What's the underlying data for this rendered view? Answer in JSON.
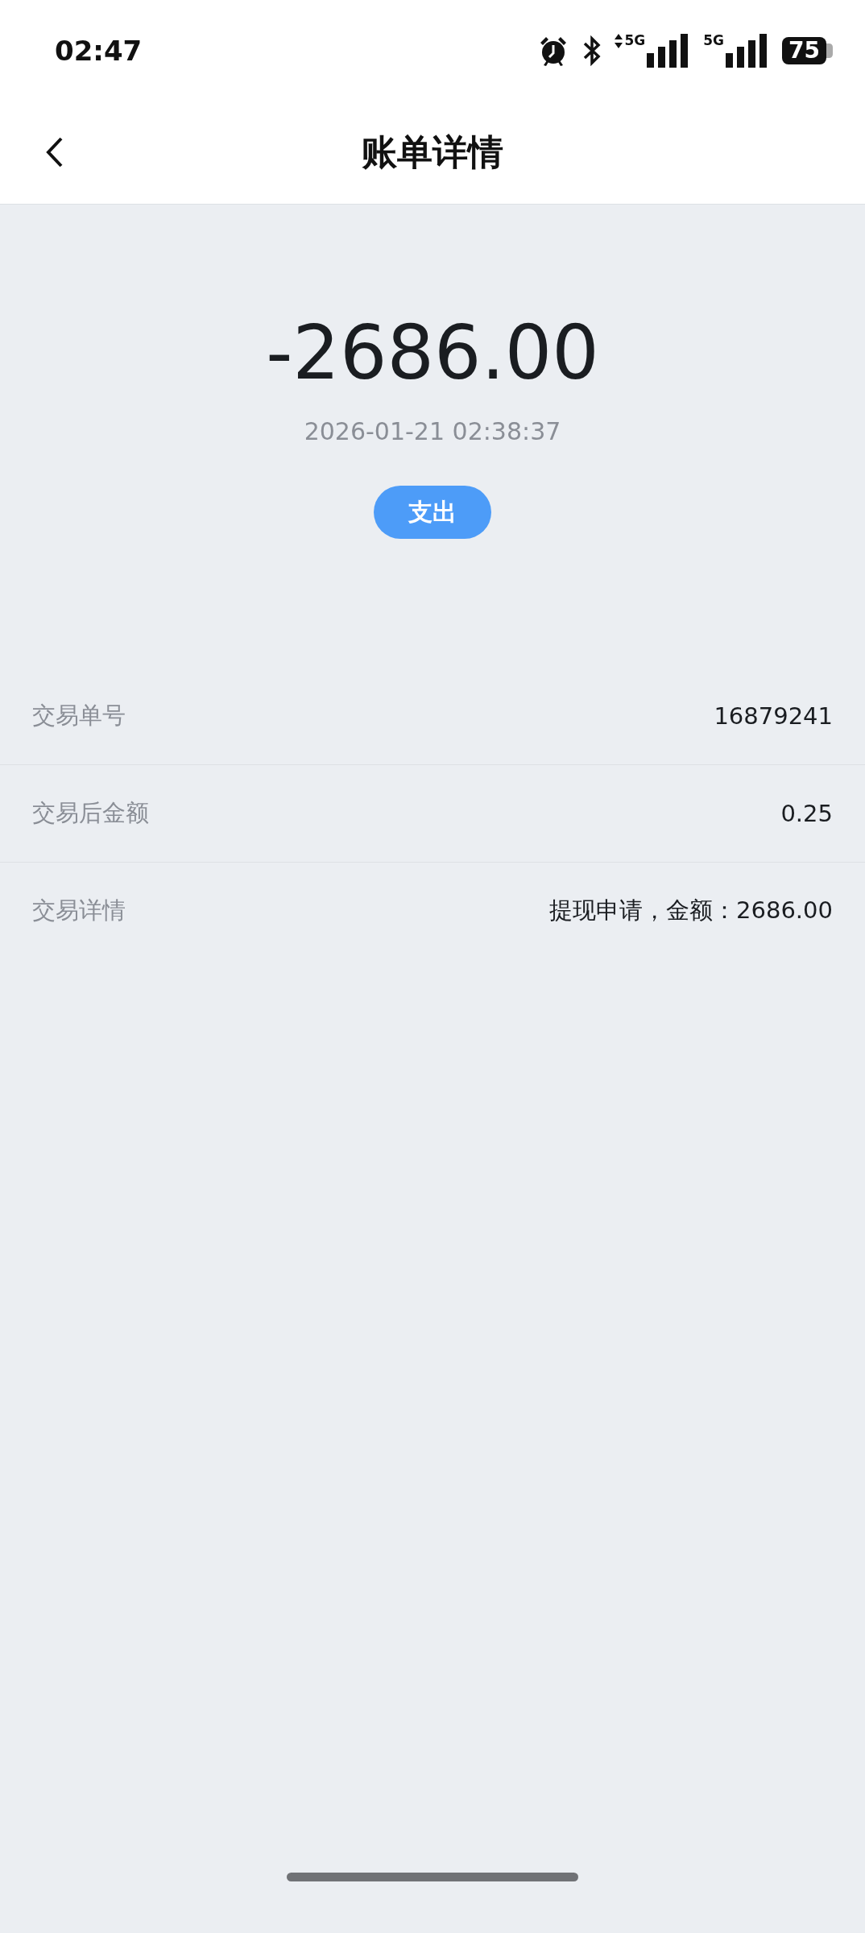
{
  "status_bar": {
    "time": "02:47",
    "network_1": "5G",
    "network_2": "5G",
    "battery": "75"
  },
  "header": {
    "title": "账单详情"
  },
  "summary": {
    "amount": "-2686.00",
    "datetime": "2026-01-21 02:38:37",
    "type_badge": "支出"
  },
  "details": [
    {
      "label": "交易单号",
      "value": "16879241"
    },
    {
      "label": "交易后金额",
      "value": "0.25"
    },
    {
      "label": "交易详情",
      "value": "提现申请，金额：2686.00"
    }
  ]
}
